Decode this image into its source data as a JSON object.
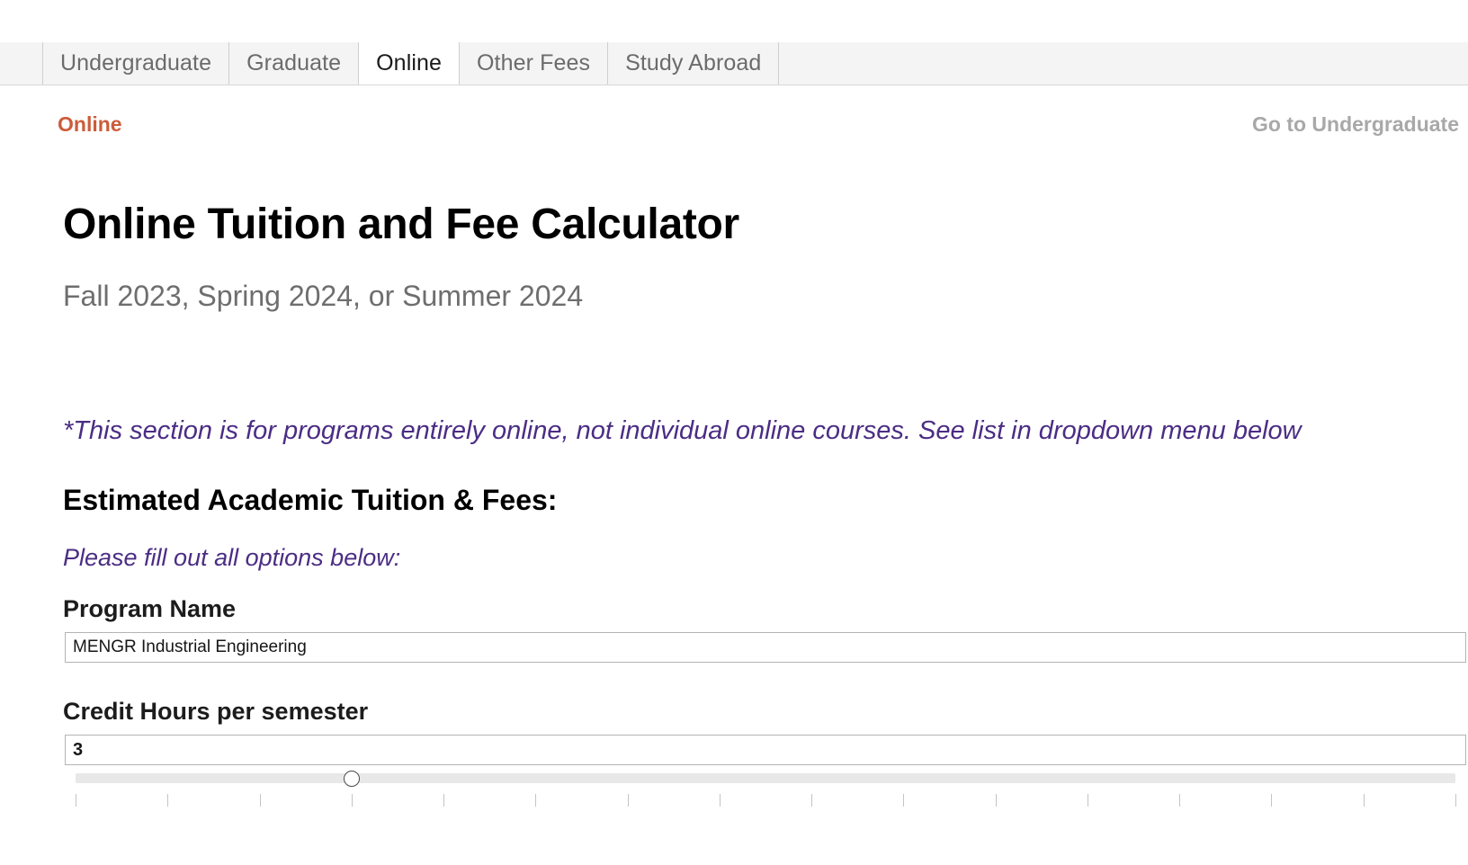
{
  "tabs": [
    {
      "label": "Undergraduate",
      "active": false
    },
    {
      "label": "Graduate",
      "active": false
    },
    {
      "label": "Online",
      "active": true
    },
    {
      "label": "Other Fees",
      "active": false
    },
    {
      "label": "Study Abroad",
      "active": false
    }
  ],
  "breadcrumb": {
    "current": "Online",
    "current_color": "#cc5c3a",
    "link": "Go to Undergraduate",
    "link_color": "#a8a8a8"
  },
  "header": {
    "title": "Online Tuition and Fee Calculator",
    "subtitle": "Fall 2023, Spring 2024, or Summer 2024"
  },
  "notes": {
    "disclaimer": "*This section is for programs entirely online, not individual online courses. See list in dropdown menu below",
    "instruction": "Please fill out all options below:",
    "color": "#4b2d84"
  },
  "section": {
    "heading": "Estimated Academic Tuition & Fees:"
  },
  "fields": {
    "program": {
      "label": "Program Name",
      "value": "MENGR Industrial Engineering",
      "placeholder": ""
    },
    "credit_hours": {
      "label": "Credit Hours per semester",
      "value": "3",
      "placeholder": "",
      "slider": {
        "min": 0,
        "max": 15,
        "value": 3,
        "tick_count": 16
      }
    }
  }
}
